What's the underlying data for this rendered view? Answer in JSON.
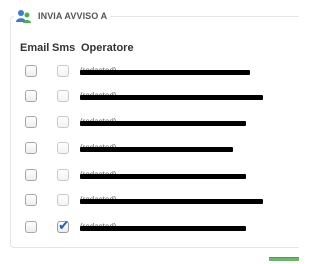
{
  "section": {
    "title": "INVIA AVVISO A",
    "icon": "user-icon"
  },
  "columns": {
    "email": "Email",
    "sms": "Sms",
    "operator": "Operatore"
  },
  "rows": [
    {
      "operator": "(redacted)",
      "email_checked": false,
      "sms_checked": false
    },
    {
      "operator": "(redacted)",
      "email_checked": false,
      "sms_checked": false
    },
    {
      "operator": "(redacted)",
      "email_checked": false,
      "sms_checked": false
    },
    {
      "operator": "(redacted)",
      "email_checked": false,
      "sms_checked": false
    },
    {
      "operator": "(redacted)",
      "email_checked": false,
      "sms_checked": false
    },
    {
      "operator": "(redacted)",
      "email_checked": false,
      "sms_checked": false
    },
    {
      "operator": "(redacted)",
      "email_checked": false,
      "sms_checked": true
    }
  ],
  "colors": {
    "accent": "#1c62c7",
    "icon_blue": "#3a7bd5",
    "icon_green": "#4caf50"
  }
}
